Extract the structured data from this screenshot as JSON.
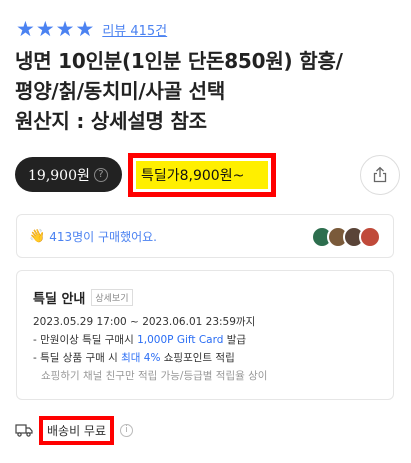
{
  "rating": {
    "stars": [
      "★",
      "★",
      "★",
      "★"
    ],
    "review_label": "리뷰 415건"
  },
  "product": {
    "title_lines": [
      "냉면 10인분(1인분 단돈850원) 함흥/",
      "평양/칡/동치미/사골 선택",
      "원산지 : 상세설명 참조"
    ]
  },
  "price": {
    "regular": "19,900원",
    "help_icon": "?",
    "deal": "특딜가8,900원~"
  },
  "buyers": {
    "hand_icon": "👋",
    "text": "413명이 구매했어요."
  },
  "deal_info": {
    "title": "특딜 안내",
    "detail_button": "상세보기",
    "period": "2023.05.29 17:00 ~ 2023.06.01 23:59까지",
    "line1_prefix": "- 만원이상 특딜 구매시 ",
    "line1_highlight": "1,000P Gift Card",
    "line1_suffix": " 발급",
    "line2_prefix": "- 특딜 상품 구매 시 ",
    "line2_highlight": "최대 4%",
    "line2_suffix": " 쇼핑포인트 적립",
    "note": "쇼핑하기 채널 친구만 적립 가능/등급별 적립율 상이"
  },
  "delivery": {
    "label": "배송비 무료",
    "info_icon": "i"
  },
  "colors": {
    "accent_blue": "#4b82f1",
    "highlight_red": "#ff0000",
    "highlight_yellow": "#ffef00",
    "price_pill": "#222222"
  }
}
